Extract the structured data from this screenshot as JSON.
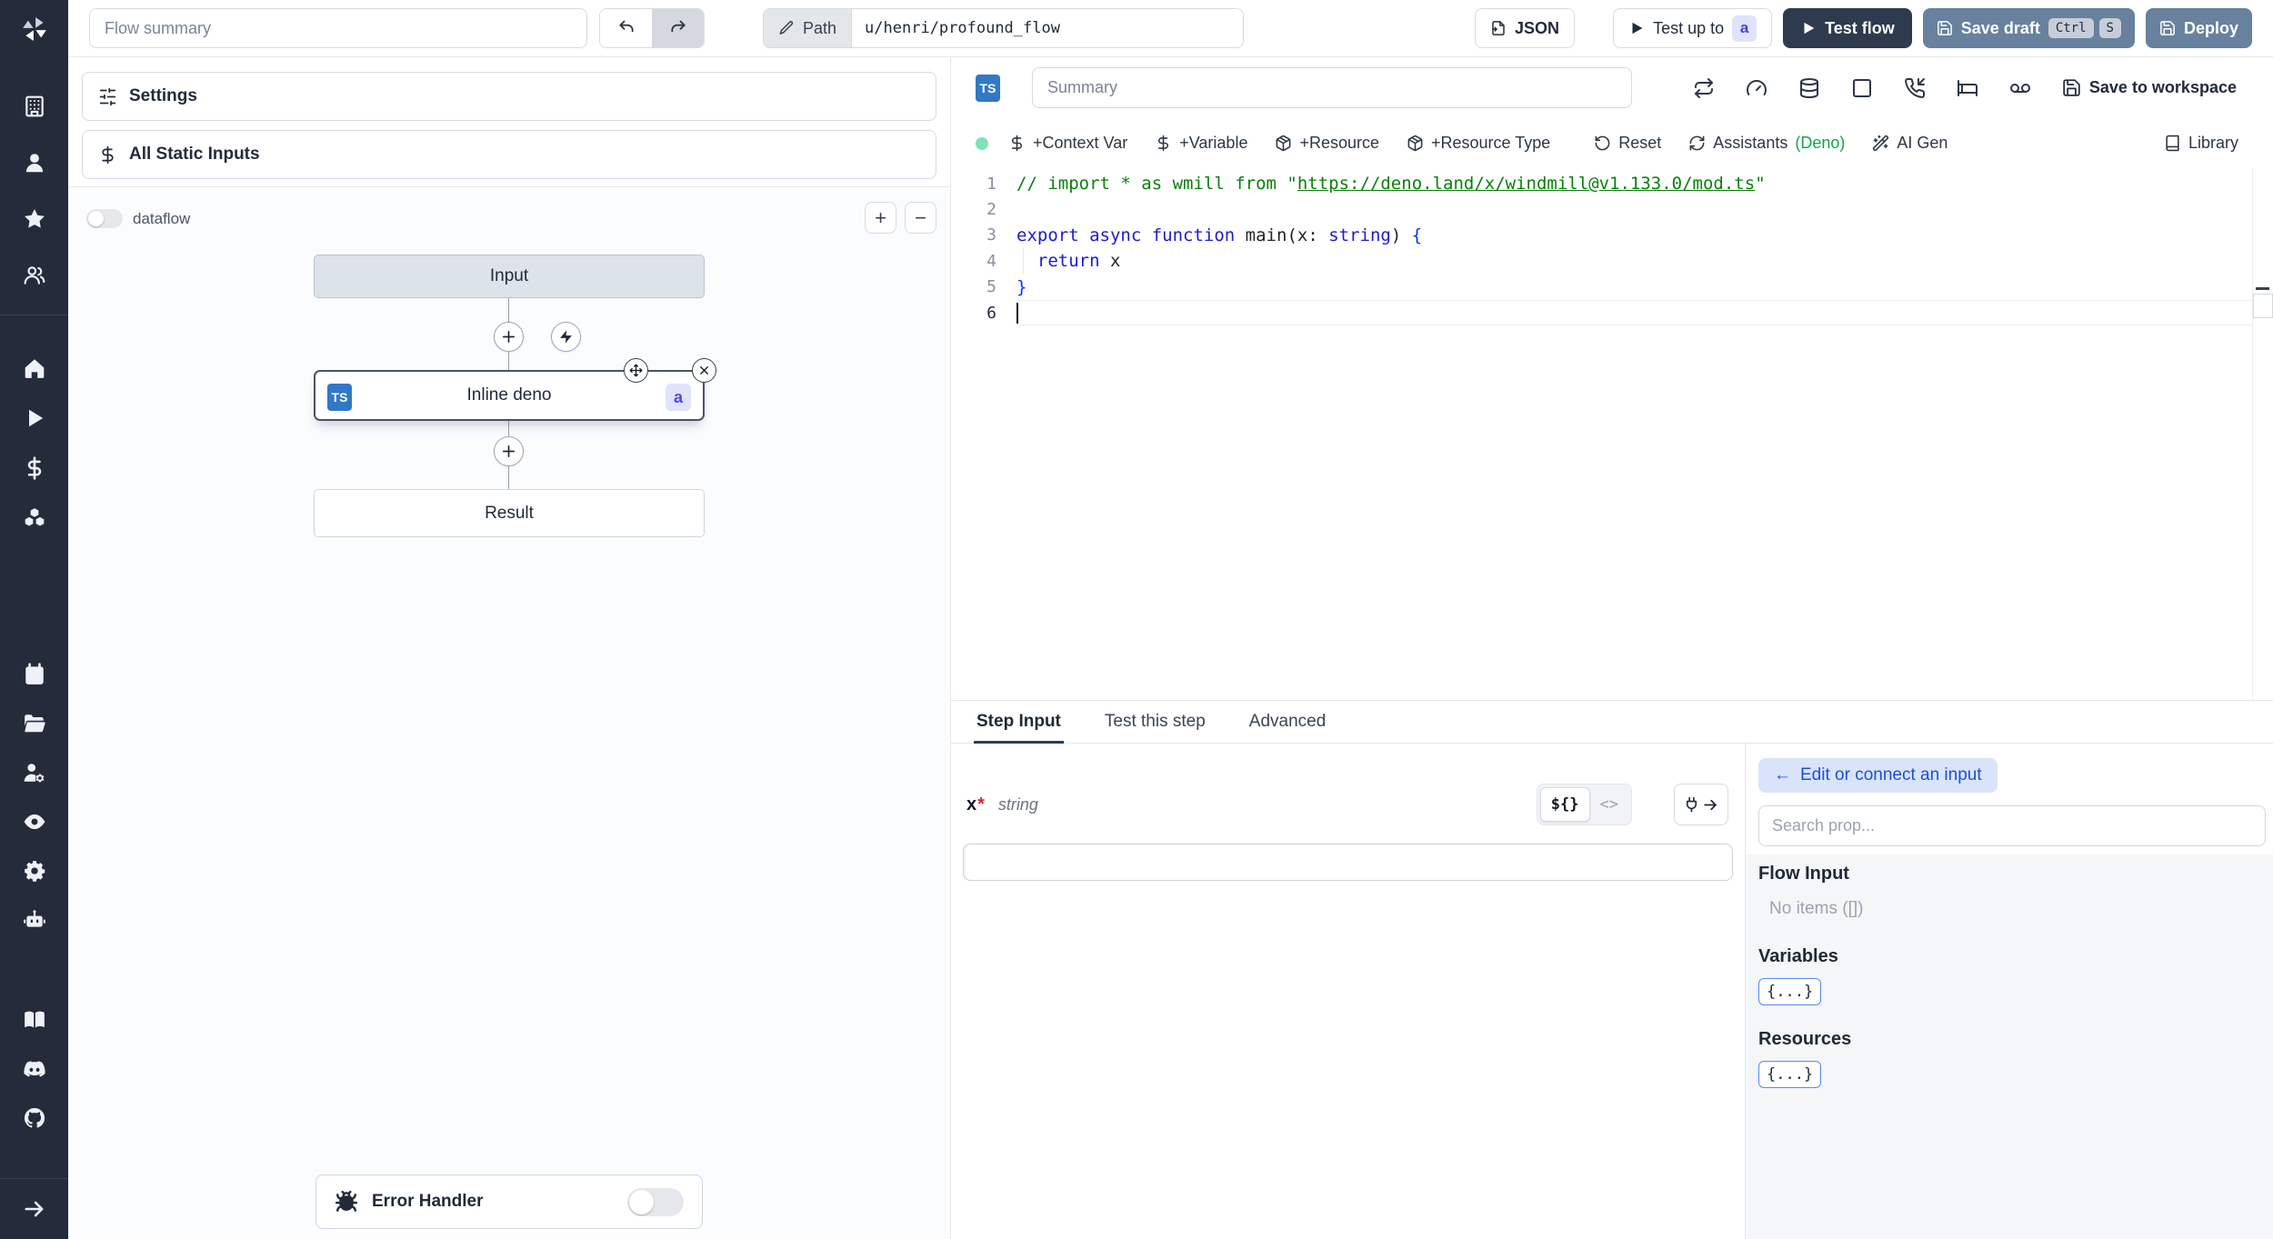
{
  "topbar": {
    "flow_summary_placeholder": "Flow summary",
    "path_label": "Path",
    "path_value": "u/henri/profound_flow",
    "json_button": "JSON",
    "test_up_to": {
      "label": "Test up to",
      "badge": "a"
    },
    "test_flow": "Test flow",
    "save_draft": {
      "label": "Save draft",
      "kbd_1": "Ctrl",
      "kbd_2": "S"
    },
    "deploy": "Deploy"
  },
  "sidebar": {
    "groups": [
      [
        "building-icon",
        "user-icon",
        "star-icon",
        "users-icon"
      ],
      [
        "home-icon",
        "play-icon",
        "dollar-icon",
        "boxes-icon"
      ],
      [
        "calendar-icon",
        "folder-open-icon",
        "user-cog-icon",
        "eye-icon",
        "settings-icon",
        "bot-icon"
      ],
      [
        "book-icon",
        "discord-icon",
        "github-icon"
      ],
      [
        "arrow-right-icon"
      ]
    ]
  },
  "flow_panel": {
    "settings": "Settings",
    "all_static_inputs": "All Static Inputs",
    "dataflow_label": "dataflow",
    "zoom_in": "+",
    "zoom_out": "−",
    "graph": {
      "input_node": "Input",
      "step_node": {
        "label": "Inline deno",
        "language_badge": "TS",
        "id_badge": "a"
      },
      "result_node": "Result"
    },
    "error_handler": "Error Handler"
  },
  "editor": {
    "language_badge": "TS",
    "summary_placeholder": "Summary",
    "status_color": "#7ce3b1",
    "buttons": {
      "context_var": "+Context Var",
      "variable": "+Variable",
      "resource": "+Resource",
      "resource_type": "+Resource Type",
      "reset": "Reset",
      "assistants": "Assistants",
      "assistants_lang": "(Deno)",
      "ai_gen": "AI Gen",
      "library": "Library",
      "save_to_workspace": "Save to workspace"
    },
    "code": {
      "lines": [
        {
          "tokens": [
            {
              "t": "// import * as wmill from \"",
              "c": "comment"
            },
            {
              "t": "https://deno.land/x/windmill@v1.133.0/mod.ts",
              "c": "comment-link"
            },
            {
              "t": "\"",
              "c": "comment"
            }
          ]
        },
        {
          "tokens": []
        },
        {
          "tokens": [
            {
              "t": "export async function ",
              "c": "kw"
            },
            {
              "t": "main",
              "c": "def"
            },
            {
              "t": "(x: ",
              "c": "def"
            },
            {
              "t": "string",
              "c": "kw"
            },
            {
              "t": ") ",
              "c": "def"
            },
            {
              "t": "{",
              "c": "brace"
            }
          ]
        },
        {
          "tokens": [
            {
              "t": "  ",
              "c": "def"
            },
            {
              "t": "return",
              "c": "kw"
            },
            {
              "t": " x",
              "c": "def"
            }
          ],
          "indent_guide": true
        },
        {
          "tokens": [
            {
              "t": "}",
              "c": "brace"
            }
          ]
        },
        {
          "tokens": [],
          "cursor": true
        }
      ]
    }
  },
  "step_panel": {
    "tabs": [
      {
        "label": "Step Input"
      },
      {
        "label": "Test this step"
      },
      {
        "label": "Advanced"
      }
    ],
    "arg": {
      "name": "x",
      "required_mark": "*",
      "type": "string"
    },
    "editor_toggle": {
      "template_option": "${}",
      "code_option": "<>"
    },
    "input_value": ""
  },
  "prop_picker": {
    "edit_connect": {
      "arrow": "←",
      "label": "Edit or connect an input"
    },
    "search_placeholder": "Search prop...",
    "flow_input_title": "Flow Input",
    "flow_input_empty": "No items ([])",
    "variables_title": "Variables",
    "variables_chip": "{...}",
    "resources_title": "Resources",
    "resources_chip": "{...}"
  },
  "colors": {
    "sidebar_bg": "#242b3a",
    "dark_button": "#2e3a4e",
    "slate_button": "#67819f",
    "ts_badge": "#3178c6",
    "id_badge_bg": "#dfe3fc",
    "id_badge_text": "#4f46e5",
    "status_green": "#7ce3b1",
    "deno_green": "#16a34a"
  }
}
